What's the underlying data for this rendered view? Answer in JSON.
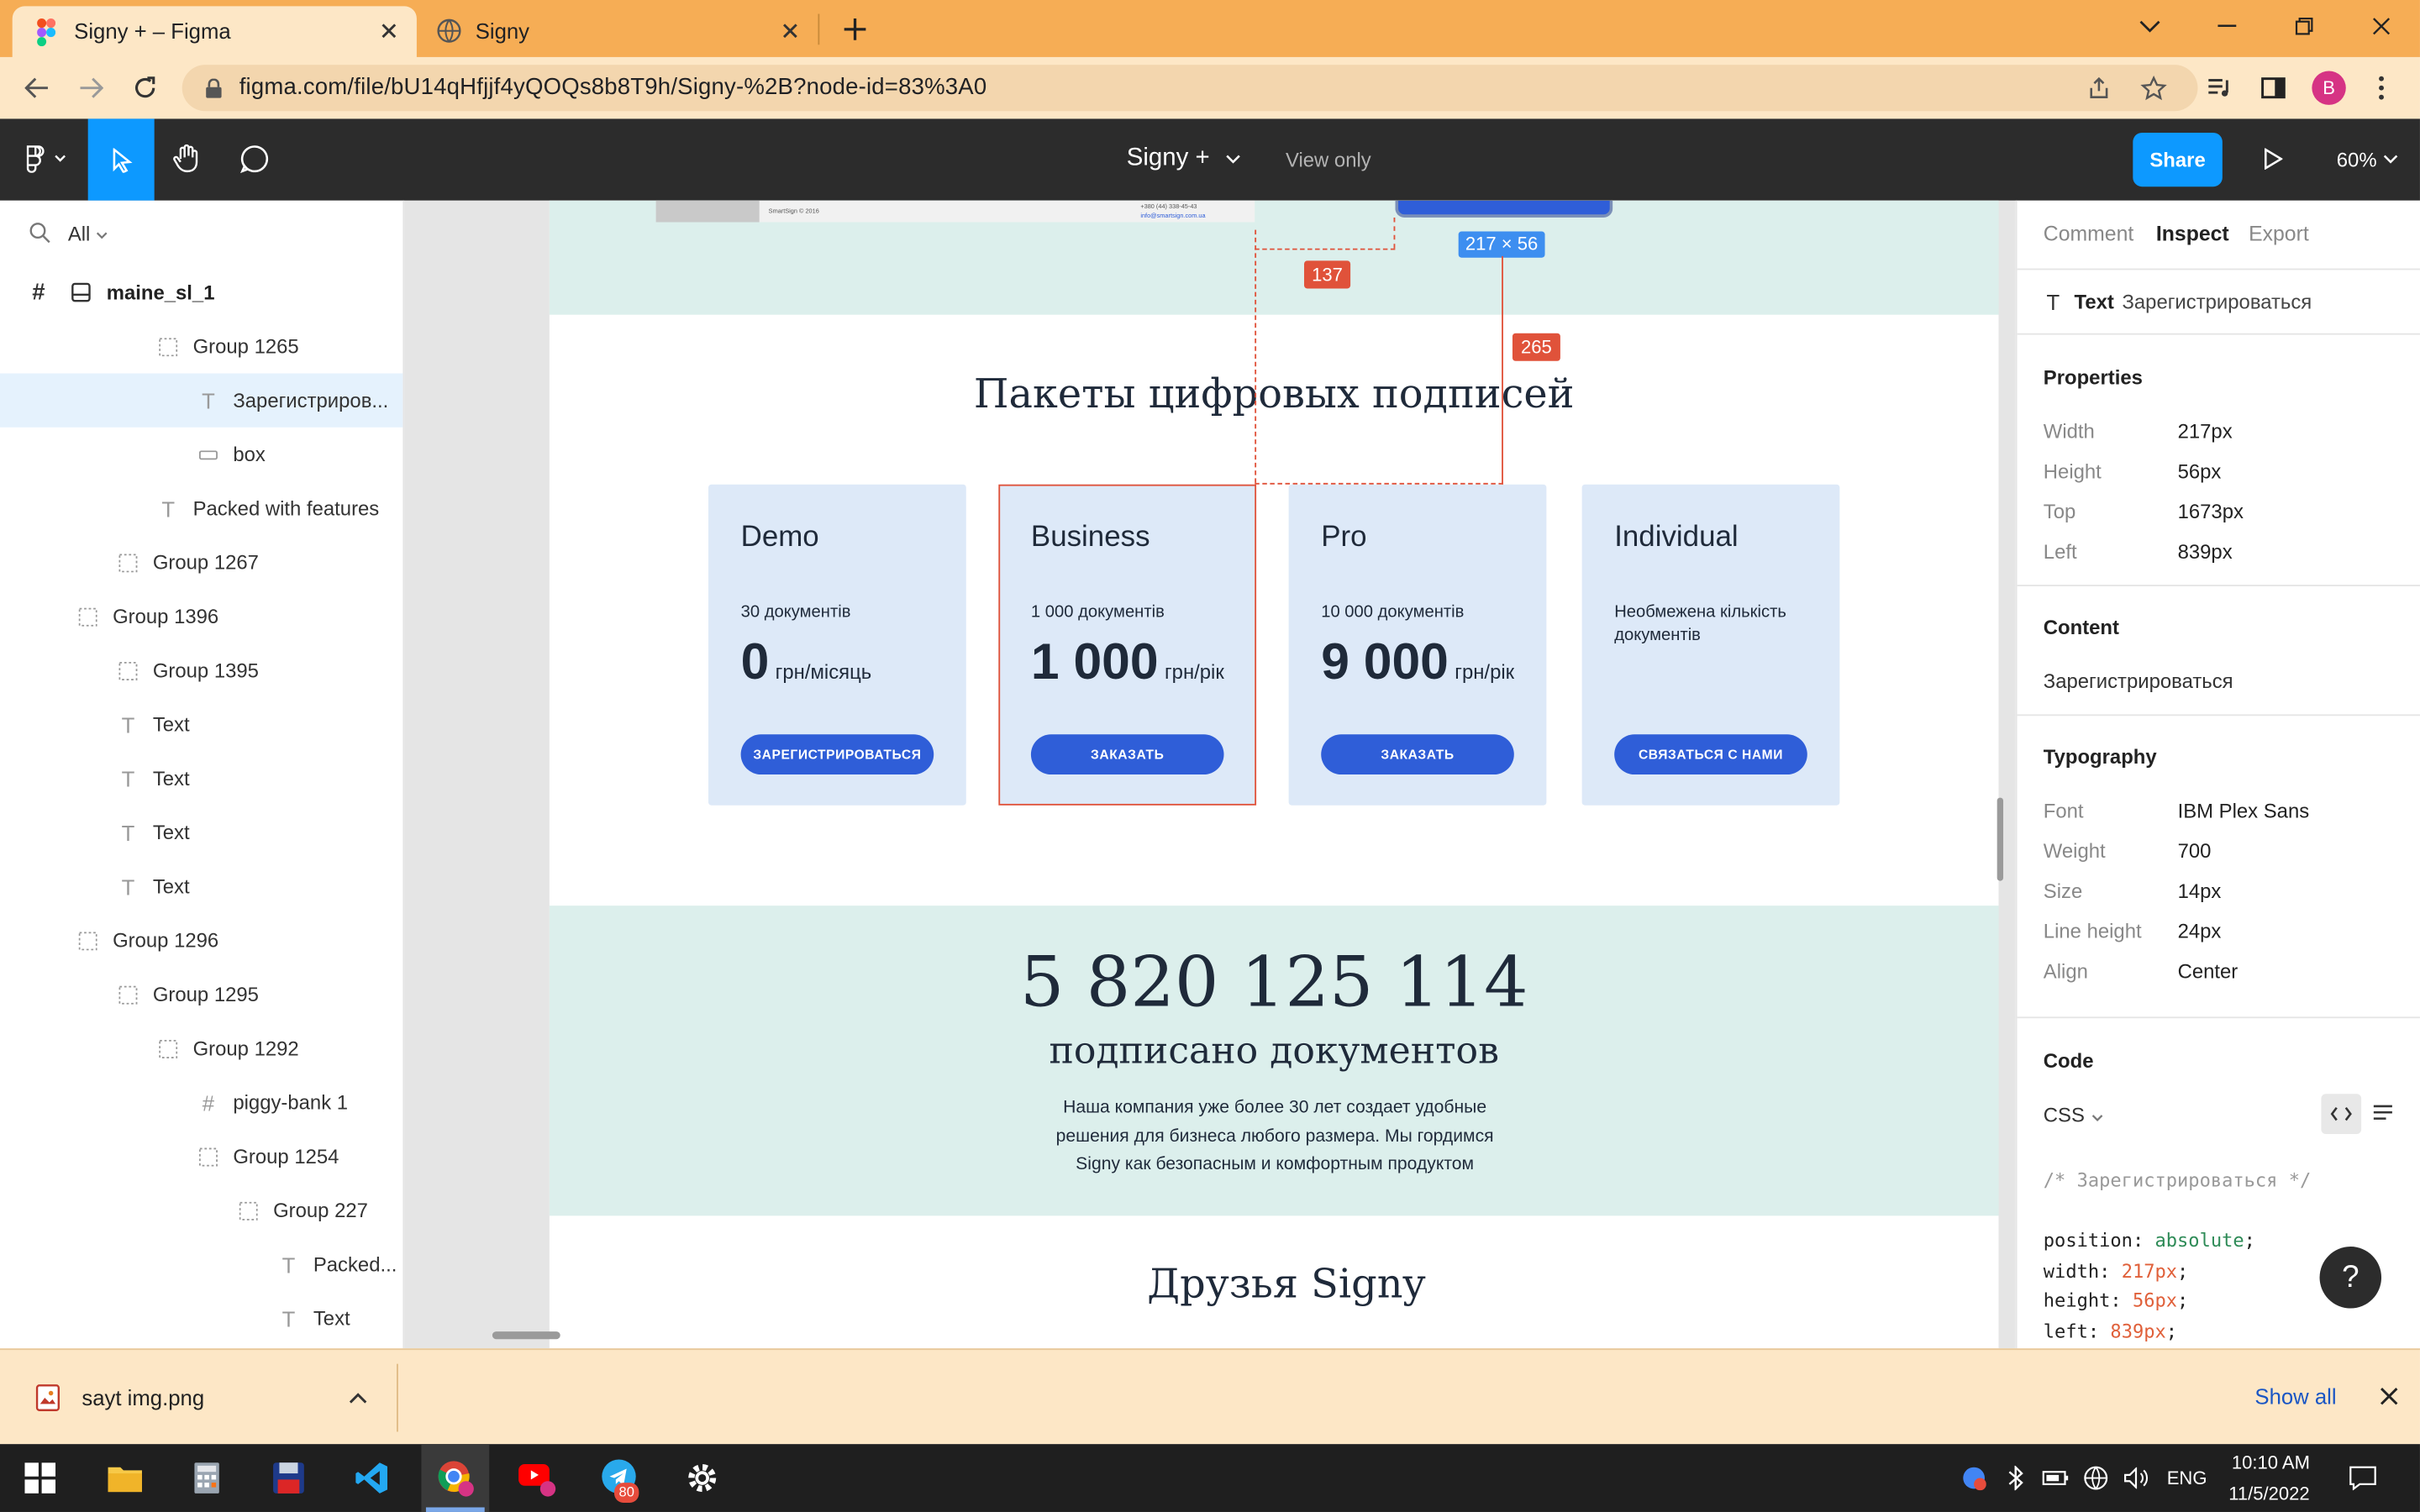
{
  "browser": {
    "tabs": [
      {
        "title": "Signy + – Figma",
        "icon": "figma-icon",
        "active": true
      },
      {
        "title": "Signy",
        "icon": "globe-icon",
        "active": false
      }
    ],
    "url": "figma.com/file/bU14qHfjjf4yQOQs8b8T9h/Signy-%2B?node-id=83%3A0",
    "avatar_letter": "B"
  },
  "figma": {
    "file_name": "Signy +",
    "view_mode": "View only",
    "share_label": "Share",
    "zoom": "60%",
    "layers_filter": "All",
    "root_frame": "maine_sl_1",
    "layers": [
      {
        "label": "Group 1265",
        "icon": "group-icon",
        "level": 3,
        "selected": false
      },
      {
        "label": "Зарегистриров...",
        "icon": "text-icon",
        "level": 4,
        "selected": true
      },
      {
        "label": "box",
        "icon": "rectangle-icon",
        "level": 4,
        "selected": false
      },
      {
        "label": "Packed with features",
        "icon": "text-icon",
        "level": 3,
        "selected": false
      },
      {
        "label": "Group 1267",
        "icon": "group-icon",
        "level": 2,
        "selected": false
      },
      {
        "label": "Group 1396",
        "icon": "group-icon",
        "level": 1,
        "selected": false
      },
      {
        "label": "Group 1395",
        "icon": "group-icon",
        "level": 2,
        "selected": false
      },
      {
        "label": "Text",
        "icon": "text-icon",
        "level": 2,
        "selected": false
      },
      {
        "label": "Text",
        "icon": "text-icon",
        "level": 2,
        "selected": false
      },
      {
        "label": "Text",
        "icon": "text-icon",
        "level": 2,
        "selected": false
      },
      {
        "label": "Text",
        "icon": "text-icon",
        "level": 2,
        "selected": false
      },
      {
        "label": "Group 1296",
        "icon": "group-icon",
        "level": 1,
        "selected": false
      },
      {
        "label": "Group 1295",
        "icon": "group-icon",
        "level": 2,
        "selected": false
      },
      {
        "label": "Group 1292",
        "icon": "group-icon",
        "level": 3,
        "selected": false
      },
      {
        "label": "piggy-bank 1",
        "icon": "frame-icon",
        "level": 4,
        "selected": false
      },
      {
        "label": "Group 1254",
        "icon": "group-icon",
        "level": 4,
        "selected": false
      },
      {
        "label": "Group 227",
        "icon": "group-icon",
        "level": 5,
        "selected": false
      },
      {
        "label": "Packed...",
        "icon": "text-icon",
        "level": 6,
        "selected": false
      },
      {
        "label": "Text",
        "icon": "text-icon",
        "level": 6,
        "selected": false
      }
    ],
    "canvas": {
      "measure_dim": "217 × 56",
      "measure_a": "137",
      "measure_b": "265",
      "footer_copyright": "SmartSign © 2016",
      "footer_phone": "+380 (44) 338-45-43",
      "footer_email": "info@smartsign.com.ua",
      "section_title": "Пакеты цифровых подписей",
      "cards": [
        {
          "name": "Demo",
          "docs": "30 документів",
          "price": "0",
          "unit": "грн/місяць",
          "button": "ЗАРЕГИСТРИРОВАТЬСЯ"
        },
        {
          "name": "Business",
          "docs": "1 000 документів",
          "price": "1 000",
          "unit": "грн/рік",
          "button": "ЗАКАЗАТЬ"
        },
        {
          "name": "Pro",
          "docs": "10 000 документів",
          "price": "9 000",
          "unit": "грн/рік",
          "button": "ЗАКАЗАТЬ"
        },
        {
          "name": "Individual",
          "docs": "Необмежена кількість документів",
          "price": "",
          "unit": "",
          "button": "СВЯЗАТЬСЯ С НАМИ"
        }
      ],
      "counter": "5 820 125 114",
      "counter_caption": "подписано документов",
      "about": "Наша компания уже более 30 лет создает удобные решения для бизнеса любого размера. Мы гордимся Signy как безопасным и комфортным продуктом",
      "friends_title": "Друзья Signy"
    },
    "inspect": {
      "tabs": [
        "Comment",
        "Inspect",
        "Export"
      ],
      "active_tab": "Inspect",
      "layer_type": "Text",
      "layer_name": "Зарегистрироваться",
      "properties_heading": "Properties",
      "properties": [
        {
          "label": "Width",
          "value": "217px"
        },
        {
          "label": "Height",
          "value": "56px"
        },
        {
          "label": "Top",
          "value": "1673px"
        },
        {
          "label": "Left",
          "value": "839px"
        }
      ],
      "content_heading": "Content",
      "content": "Зарегистрироваться",
      "typography_heading": "Typography",
      "typography": [
        {
          "label": "Font",
          "value": "IBM Plex Sans"
        },
        {
          "label": "Weight",
          "value": "700"
        },
        {
          "label": "Size",
          "value": "14px"
        },
        {
          "label": "Line height",
          "value": "24px"
        },
        {
          "label": "Align",
          "value": "Center"
        }
      ],
      "code_heading": "Code",
      "code_lang": "CSS",
      "code_comment": "/* Зарегистрироваться */",
      "code_lines": [
        {
          "prop": "position: ",
          "val": "absolute",
          "color": "#2e8b57"
        },
        {
          "prop": "width: ",
          "val": "217px",
          "color": "#e0603a"
        },
        {
          "prop": "height: ",
          "val": "56px",
          "color": "#e0603a"
        },
        {
          "prop": "left: ",
          "val": "839px",
          "color": "#e0603a"
        }
      ]
    }
  },
  "downloads": {
    "file": "sayt img.png",
    "show_all": "Show all"
  },
  "taskbar": {
    "lang": "ENG",
    "time": "10:10 AM",
    "date": "11/5/2022",
    "telegram_badge": "80"
  },
  "colors": {
    "accent": "#0d99ff",
    "chrome_tab": "#f6ad55",
    "card_bg": "#dde9f8",
    "button_blue": "#2f5ed8",
    "measure_red": "#e0523a"
  }
}
